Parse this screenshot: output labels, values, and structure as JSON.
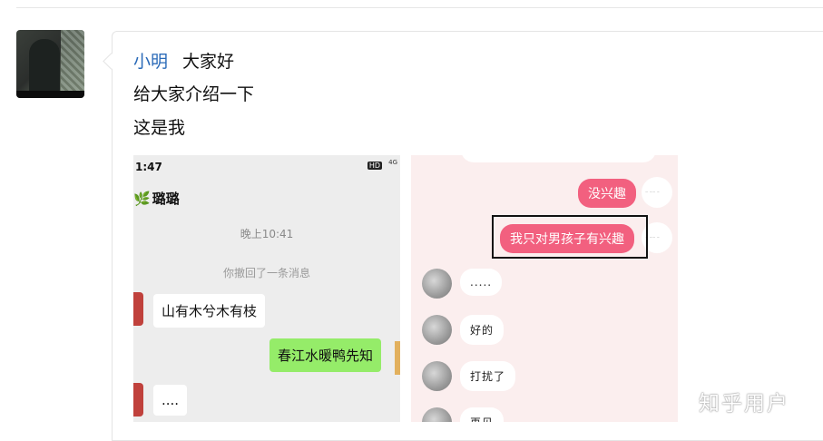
{
  "post": {
    "author": "小明",
    "lines": [
      "大家好",
      "给大家介绍一下",
      "这是我"
    ]
  },
  "left_screenshot": {
    "time": "1:47",
    "hd_badge": "HD",
    "signal": "4G",
    "contact_name": "璐璐",
    "timestamp": "晚上10:41",
    "recall_notice": "你撤回了一条消息",
    "messages": [
      {
        "side": "left",
        "text": "山有木兮木有枝"
      },
      {
        "side": "right",
        "text": "春江水暖鸭先知"
      },
      {
        "side": "left",
        "text": "...."
      }
    ]
  },
  "right_screenshot": {
    "messages": [
      {
        "side": "right",
        "text": "没兴趣"
      },
      {
        "side": "right",
        "text": "我只对男孩子有兴趣",
        "highlighted": true
      },
      {
        "side": "left",
        "text": "....."
      },
      {
        "side": "left",
        "text": "好的"
      },
      {
        "side": "left",
        "text": "打扰了"
      },
      {
        "side": "left",
        "text": "再见"
      }
    ],
    "colors": {
      "outgoing_bubble": "#f2607f",
      "background": "#fbeeee"
    }
  },
  "watermark": "知乎用户",
  "colors": {
    "author_link": "#2a6ab8",
    "wechat_green": "#95ec69"
  }
}
